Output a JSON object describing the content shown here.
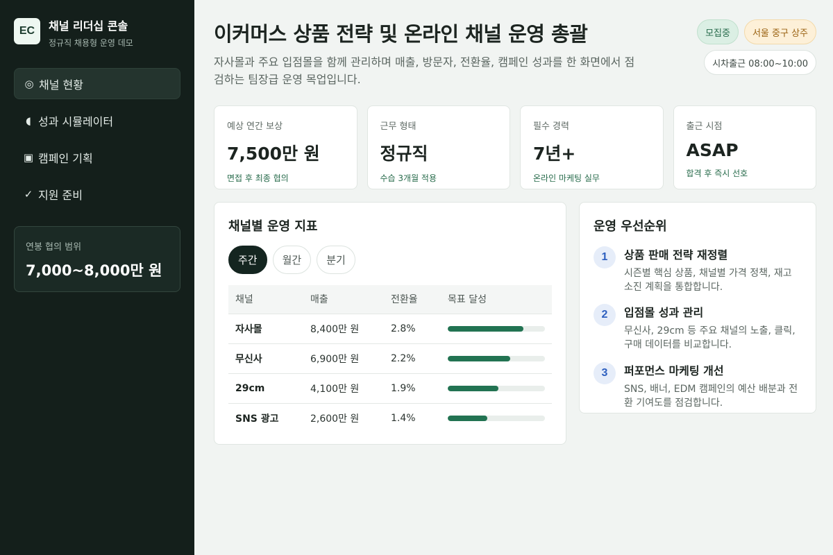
{
  "brand": {
    "logo": "EC",
    "title": "채널 리더십 콘솔",
    "subtitle": "정규직 채용형 운영 데모"
  },
  "sidebar": {
    "items": [
      {
        "icon": "◎",
        "icon_name": "target-icon",
        "label": "채널 현황",
        "active": true
      },
      {
        "icon": "◖",
        "icon_name": "half-circle-icon",
        "label": "성과 시뮬레이터",
        "active": false
      },
      {
        "icon": "▣",
        "icon_name": "square-icon",
        "label": "캠페인 기획",
        "active": false
      },
      {
        "icon": "✓",
        "icon_name": "check-icon",
        "label": "지원 준비",
        "active": false
      }
    ],
    "salary": {
      "label": "연봉 협의 범위",
      "value": "7,000~8,000만 원"
    }
  },
  "header": {
    "title": "이커머스 상품 전략 및 온라인 채널 운영 총괄",
    "description": "자사몰과 주요 입점몰을 함께 관리하며 매출, 방문자, 전환율, 캠페인 성과를 한 화면에서 점검하는 팀장급 운영 목업입니다.",
    "badges": [
      "모집중",
      "서울 중구 상주"
    ],
    "schedule": "시차출근 08:00~10:00"
  },
  "stats": [
    {
      "label": "예상 연간 보상",
      "value": "7,500만 원",
      "note": "면접 후 최종 협의"
    },
    {
      "label": "근무 형태",
      "value": "정규직",
      "note": "수습 3개월 적용"
    },
    {
      "label": "필수 경력",
      "value": "7년+",
      "note": "온라인 마케팅 실무"
    },
    {
      "label": "출근 시점",
      "value": "ASAP",
      "note": "합격 후 즉시 선호"
    }
  ],
  "metrics": {
    "title": "채널별 운영 지표",
    "tabs": [
      "주간",
      "월간",
      "분기"
    ],
    "active_tab": 0,
    "columns": [
      "채널",
      "매출",
      "전환율",
      "목표 달성"
    ],
    "rows": [
      {
        "channel": "자사몰",
        "sales": "8,400만 원",
        "conversion": "2.8%",
        "goal_progress": 0.78
      },
      {
        "channel": "무신사",
        "sales": "6,900만 원",
        "conversion": "2.2%",
        "goal_progress": 0.64
      },
      {
        "channel": "29cm",
        "sales": "4,100만 원",
        "conversion": "1.9%",
        "goal_progress": 0.52
      },
      {
        "channel": "SNS 광고",
        "sales": "2,600만 원",
        "conversion": "1.4%",
        "goal_progress": 0.41
      }
    ]
  },
  "priorities": {
    "title": "운영 우선순위",
    "items": [
      {
        "num": "1",
        "title": "상품 판매 전략 재정렬",
        "desc": "시즌별 핵심 상품, 채널별 가격 정책, 재고 소진 계획을 통합합니다."
      },
      {
        "num": "2",
        "title": "입점몰 성과 관리",
        "desc": "무신사, 29cm 등 주요 채널의 노출, 클릭, 구매 데이터를 비교합니다."
      },
      {
        "num": "3",
        "title": "퍼포먼스 마케팅 개선",
        "desc": "SNS, 배너, EDM 캠페인의 예산 배분과 전환 기여도를 점검합니다."
      }
    ]
  },
  "colors": {
    "sidebar_bg": "#141f1b",
    "accent_green": "#227352",
    "badge_green": "#dbefe4",
    "badge_orange": "#fdf0d8",
    "priority_blue": "#2d5fbf"
  }
}
